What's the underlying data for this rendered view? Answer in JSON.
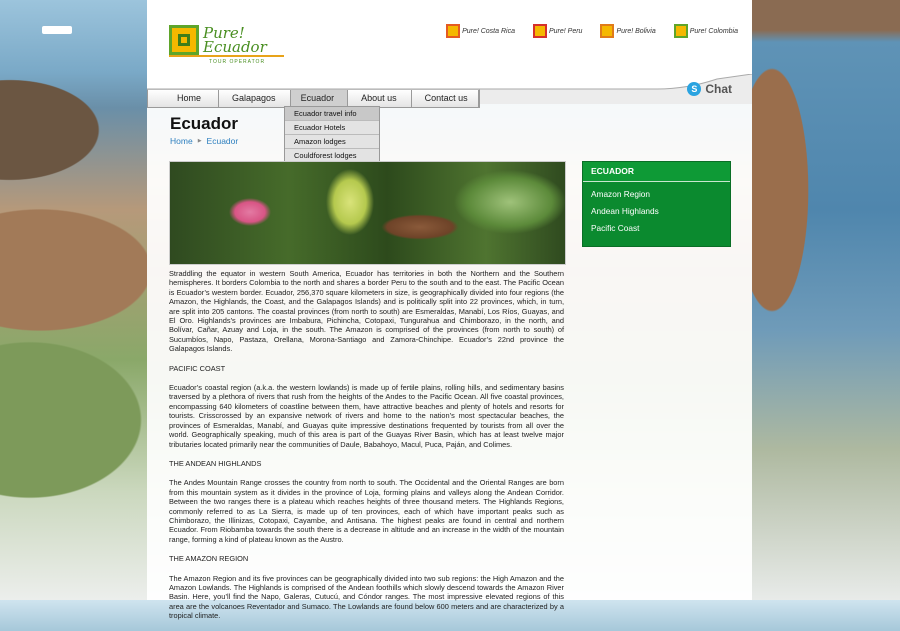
{
  "brand": {
    "name": "Pure! Ecuador",
    "sub": "TOUR OPERATOR"
  },
  "partners": [
    {
      "name": "Pure! Costa Rica",
      "color": "#e55b22"
    },
    {
      "name": "Pure! Peru",
      "color": "#d6302b"
    },
    {
      "name": "Pure! Bolivia",
      "color": "#e07b19"
    },
    {
      "name": "Pure! Colombia",
      "color": "#5fa52a"
    }
  ],
  "chat": {
    "label": "Chat",
    "icon": "skype-icon"
  },
  "nav": [
    "Home",
    "Galapagos",
    "Ecuador",
    "About us",
    "Contact us"
  ],
  "dropdown": [
    "Ecuador travel info",
    "Ecuador Hotels",
    "Amazon lodges",
    "Couldforest lodges"
  ],
  "page": {
    "title": "Ecuador",
    "breadcrumb": [
      "Home",
      "Ecuador"
    ]
  },
  "sidebar": {
    "title": "ECUADOR",
    "items": [
      "Amazon Region",
      "Andean Highlands",
      "Pacific Coast"
    ],
    "color": "#0b8a2f"
  },
  "content": {
    "p1": "Straddling the equator in western South America, Ecuador has territories in both the Northern and the Southern hemispheres. It borders Colombia to the north and shares a border Peru to the south and to the east. The Pacific Ocean is Ecuador’s western border. Ecuador, 256,370 square kilometers in size, is geographically divided into four regions (the Amazon, the Highlands, the Coast, and the Galapagos Islands) and is politically split into 22 provinces, which, in turn, are split into 205 cantons. The coastal provinces (from north to south) are Esmeraldas, Manabí, Los Ríos, Guayas, and El Oro. Highlands’s provinces are Imbabura, Pichincha, Cotopaxi, Tungurahua and Chimborazo, in the north, and Bolívar, Cañar, Azuay and Loja, in the south. The Amazon is comprised of the provinces (from north to south) of Sucumbíos, Napo, Pastaza, Orellana, Morona-Santiago and Zamora-Chinchipe. Ecuador’s 22nd province the Galapagos Islands.",
    "h1": "PACIFIC COAST",
    "p2": "Ecuador’s coastal region (a.k.a. the western lowlands) is made up of fertile plains, rolling hills, and sedimentary basins traversed by a plethora of rivers that rush from the heights of the Andes to the Pacific Ocean. All five coastal provinces, encompassing 640 kilometers of coastline between them, have attractive beaches and plenty of hotels and resorts for tourists. Crisscrossed by an expansive network of rivers and home to the nation’s most spectacular beaches, the provinces of Esmeraldas, Manabí, and Guayas quite impressive destinations frequented by tourists from all over the world. Geographically speaking, much of this area is part of the Guayas River Basin, which has at least twelve major tributaries located primarily near the communities of Daule, Babahoyo, Macul, Puca, Paján, and Colimes.",
    "h2": "THE ANDEAN HIGHLANDS",
    "p3": "The Andes Mountain Range crosses the country from north to south. The Occidental and the Oriental Ranges are born from this mountain system as it divides in the province of Loja, forming plains and valleys along the Andean Corridor. Between the two ranges there is a plateau which reaches heights of three thousand meters. The Highlands Regions, commonly referred to as La Sierra, is made up of ten provinces, each of which have important peaks such as Chimborazo, the Illinizas, Cotopaxi, Cayambe, and Antisana. The highest peaks are found in central and northern Ecuador. From Riobamba towards the south there is a decrease in altitude and an increase in the width of the mountain range, forming a kind of plateau known as the Austro.",
    "h3": "THE AMAZON REGION",
    "p4": "The Amazon Region and its five provinces can be geographically divided into two sub regions: the High Amazon and the Amazon Lowlands. The Highlands is comprised of the Andean foothills which slowly descend towards the Amazon River Basin. Here, you’ll find the Napo, Galeras, Cutucú, and Cóndor ranges. The most impressive elevated regions of this area are the volcanoes Reventador and Sumaco. The Lowlands are found below 600 meters and are characterized by a tropical climate."
  }
}
